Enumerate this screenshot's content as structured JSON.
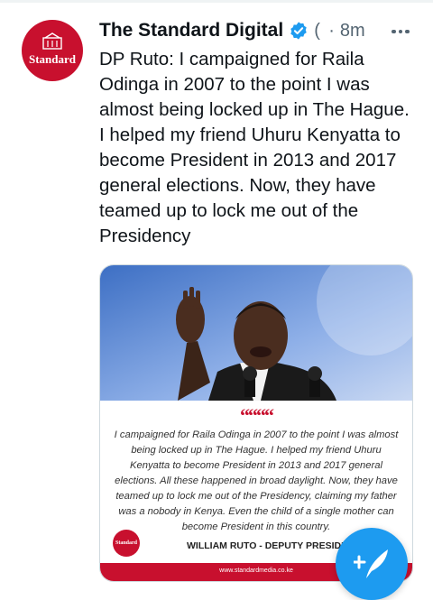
{
  "tweet": {
    "author": {
      "display_name": "The Standard Digital",
      "avatar_text": "Standard",
      "handle": "(",
      "verified": true
    },
    "separator": "·",
    "timestamp": "8m",
    "text": "DP Ruto: I campaigned for Raila Odinga in 2007 to the point I was almost being locked up in The Hague. I helped my friend Uhuru Kenyatta to become President in 2013 and 2017 general elections. Now, they have teamed up to lock me out of the Presidency",
    "media": {
      "quote_mark": "““““",
      "quote": "I campaigned for Raila Odinga in 2007 to the point I was almost being locked up in The Hague. I helped my friend Uhuru Kenyatta to become President in 2013 and 2017 general elections. All these happened in broad daylight. Now, they have teamed up to lock me out of the Presidency, claiming my father was a nobody in Kenya. Even the child of a single mother can become President in this country.",
      "logo_text": "Standard",
      "attribution": "WILLIAM RUTO - DEPUTY PRESIDENT",
      "footer": "www.standardmedia.co.ke"
    }
  },
  "colors": {
    "accent": "#1d9bf0",
    "brand_red": "#c8102e",
    "secondary_text": "#536471"
  },
  "icons": {
    "verified": "verified-badge-icon",
    "more": "more-options-icon",
    "compose": "compose-tweet-icon"
  }
}
